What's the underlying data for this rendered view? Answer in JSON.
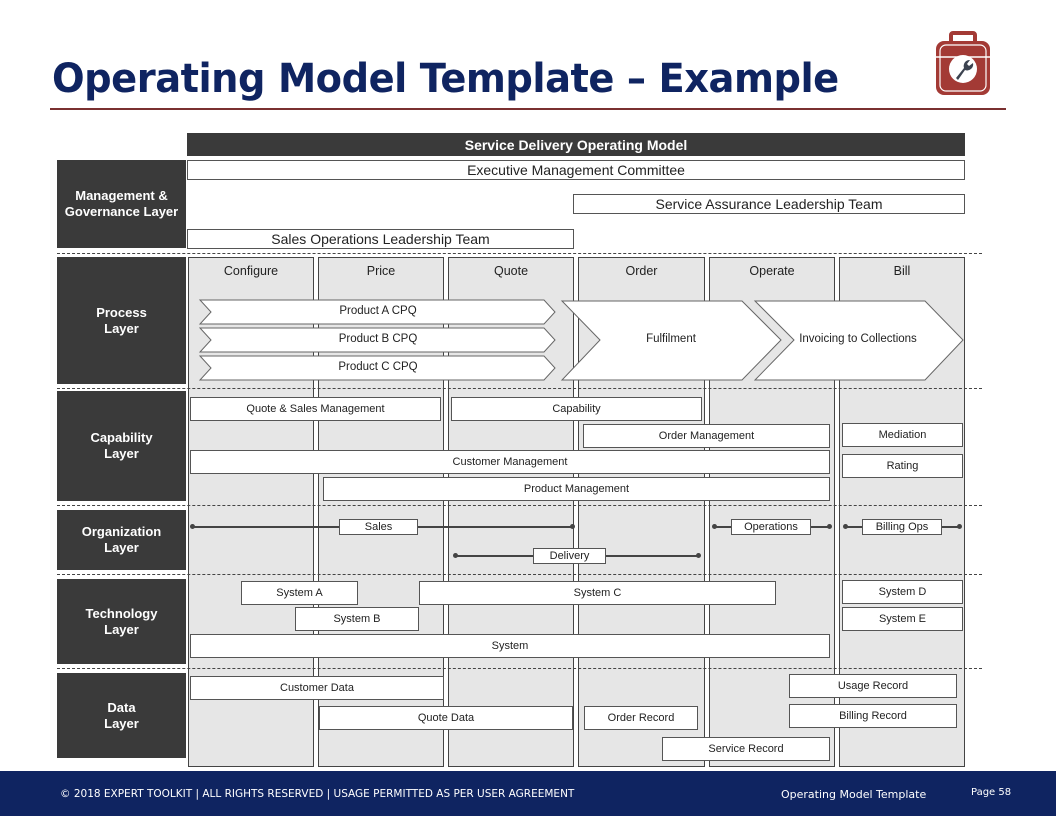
{
  "page": {
    "title": "Operating Model Template – Example",
    "logo_icon": "toolbox-wrench-icon"
  },
  "diagram": {
    "header": "Service Delivery Operating Model",
    "layers": [
      {
        "label_line1": "Management &",
        "label_line2": "Governance Layer"
      },
      {
        "label_line1": "Process",
        "label_line2": "Layer"
      },
      {
        "label_line1": "Capability",
        "label_line2": "Layer"
      },
      {
        "label_line1": "Organization",
        "label_line2": "Layer"
      },
      {
        "label_line1": "Technology",
        "label_line2": "Layer"
      },
      {
        "label_line1": "Data",
        "label_line2": "Layer"
      }
    ],
    "stages": [
      "Configure",
      "Price",
      "Quote",
      "Order",
      "Operate",
      "Bill"
    ],
    "governance": {
      "executive": "Executive Management Committee",
      "service_assurance": "Service Assurance Leadership Team",
      "sales_ops": "Sales Operations Leadership Team"
    },
    "process": {
      "cpq": [
        "Product A CPQ",
        "Product B CPQ",
        "Product C CPQ"
      ],
      "fulfilment": "Fulfilment",
      "invoicing": "Invoicing to Collections"
    },
    "capability": {
      "quote_sales": "Quote & Sales Management",
      "capability": "Capability",
      "order_mgmt": "Order Management",
      "mediation": "Mediation",
      "customer_mgmt": "Customer Management",
      "rating": "Rating",
      "product_mgmt": "Product Management"
    },
    "organization": {
      "sales": "Sales",
      "delivery": "Delivery",
      "operations": "Operations",
      "billing_ops": "Billing Ops"
    },
    "technology": {
      "system_a": "System A",
      "system_b": "System B",
      "system_c": "System C",
      "system_d": "System D",
      "system_e": "System E",
      "system": "System"
    },
    "data_layer": {
      "customer_data": "Customer Data",
      "quote_data": "Quote Data",
      "order_record": "Order Record",
      "service_record": "Service Record",
      "usage_record": "Usage Record",
      "billing_record": "Billing Record"
    }
  },
  "footer": {
    "copyright": "© 2018 EXPERT TOOLKIT | ALL RIGHTS RESERVED | USAGE PERMITTED AS PER USER AGREEMENT",
    "doc_name": "Operating Model Template",
    "page": "Page 58"
  },
  "colors": {
    "title": "#0f2461",
    "footer_bg": "#0f2461",
    "layer_label_bg": "#3a3a3a",
    "column_bg": "#e6e6e6",
    "logo_red": "#a33a35",
    "rule": "#7a3030"
  }
}
